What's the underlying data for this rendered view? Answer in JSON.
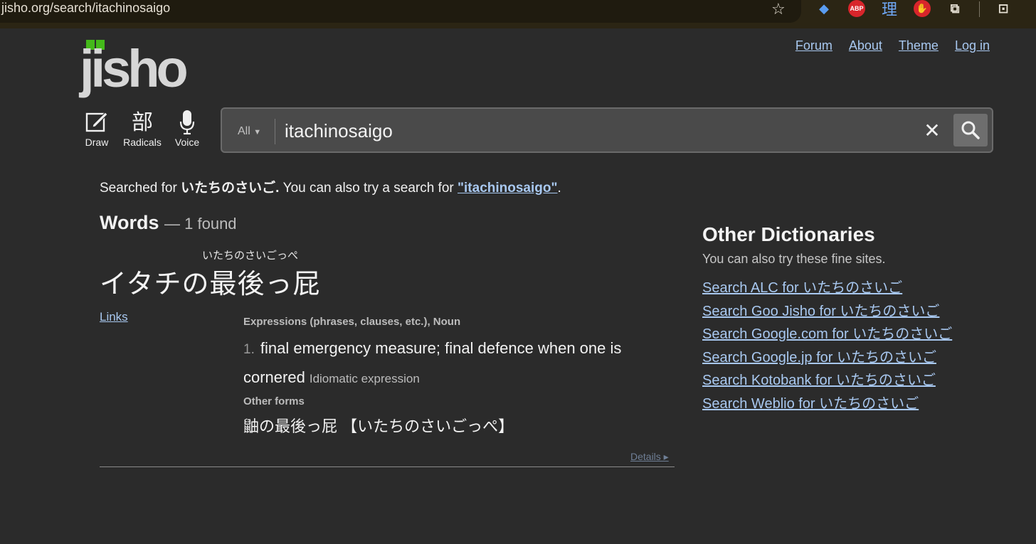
{
  "browser": {
    "url": "jisho.org/search/itachinosaigo",
    "extensions": {
      "abp": "ABP",
      "kanji": "理"
    }
  },
  "logo": {
    "text": "jisho"
  },
  "topnav": [
    {
      "label": "Forum"
    },
    {
      "label": "About"
    },
    {
      "label": "Theme"
    },
    {
      "label": "Log in"
    }
  ],
  "tools": {
    "draw": {
      "label": "Draw"
    },
    "radicals": {
      "label": "Radicals",
      "glyph": "部"
    },
    "voice": {
      "label": "Voice"
    }
  },
  "search": {
    "filter": "All",
    "query": "itachinosaigo"
  },
  "searched": {
    "prefix": "Searched for ",
    "term": "いたちのさいご.",
    "middle": " You can also try a search for ",
    "alt_link": "\"itachinosaigo\"",
    "suffix": "."
  },
  "words": {
    "title": "Words",
    "count": "— 1 found"
  },
  "entry": {
    "furigana": "いたちのさいごっぺ",
    "word": "イタチの最後っ屁",
    "links_label": "Links",
    "pos": "Expressions (phrases, clauses, etc.), Noun",
    "sense_number": "1.",
    "meaning": "final emergency measure; final defence when one is cornered",
    "tag": "Idiomatic expression",
    "other_forms_label": "Other forms",
    "other_forms": "鼬の最後っ屁 【いたちのさいごっぺ】",
    "details_label": "Details ▸"
  },
  "other_dictionaries": {
    "title": "Other Dictionaries",
    "subtitle": "You can also try these fine sites.",
    "links": [
      "Search ALC for いたちのさいご",
      "Search Goo Jisho for いたちのさいご",
      "Search Google.com for いたちのさいご",
      "Search Google.jp for いたちのさいご",
      "Search Kotobank for いたちのさいご",
      "Search Weblio for いたちのさいご"
    ]
  },
  "colors": {
    "background": "#2b2b2b",
    "link": "#a8c8f0",
    "logo_green": "#44b91a"
  }
}
